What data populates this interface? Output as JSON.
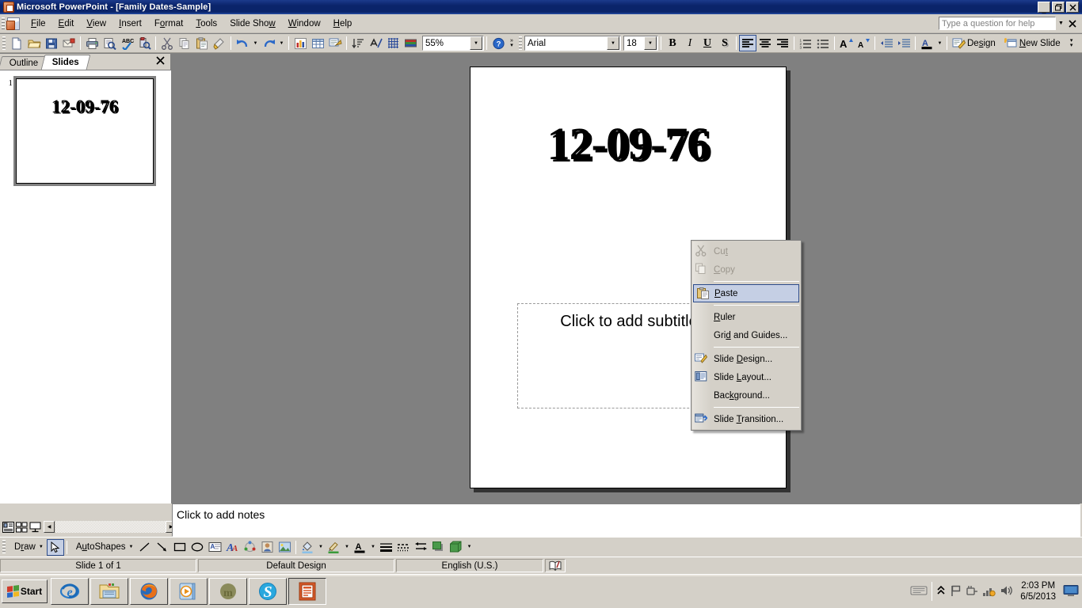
{
  "window": {
    "title": "Microsoft PowerPoint - [Family Dates-Sample]",
    "app_icon": "powerpoint-icon",
    "minimize_label": "_",
    "restore_label": "❐",
    "close_label": "✕"
  },
  "menubar": {
    "items": [
      {
        "label": "File",
        "accel": "F"
      },
      {
        "label": "Edit",
        "accel": "E"
      },
      {
        "label": "View",
        "accel": "V"
      },
      {
        "label": "Insert",
        "accel": "I"
      },
      {
        "label": "Format",
        "accel": "o"
      },
      {
        "label": "Tools",
        "accel": "T"
      },
      {
        "label": "Slide Show",
        "accel": "S"
      },
      {
        "label": "Window",
        "accel": "W"
      },
      {
        "label": "Help",
        "accel": "H"
      }
    ],
    "help_placeholder": "Type a question for help",
    "help_value": "",
    "help_close_label": "✕"
  },
  "standard_toolbar": {
    "zoom_value": "55%",
    "buttons": [
      "new-icon",
      "open-icon",
      "save-icon",
      "mail-icon",
      "print-icon",
      "print-preview-icon",
      "spelling-icon",
      "research-icon",
      "cut-icon",
      "copy-icon",
      "paste-icon",
      "format-painter-icon",
      "undo-icon",
      "redo-icon",
      "insert-chart-icon",
      "insert-table-icon",
      "insert-diagram-icon",
      "sort-icon",
      "expand-all-icon",
      "show-grid-icon",
      "color-grayscale-icon",
      "help-icon"
    ]
  },
  "formatting_toolbar": {
    "font_name": "Arial",
    "font_size": "18",
    "bold_label": "B",
    "italic_label": "I",
    "underline_label": "U",
    "shadow_label": "S",
    "align_left_label": "align-left-icon",
    "align_center_label": "align-center-icon",
    "align_right_label": "align-right-icon",
    "numbering_label": "numbering-icon",
    "bullets_label": "bullets-icon",
    "increase_font_label": "A",
    "decrease_font_label": "A",
    "decrease_indent_label": "decrease-indent-icon",
    "increase_indent_label": "increase-indent-icon",
    "font_color_label": "A",
    "design_label": "Design",
    "design_accel": "s",
    "new_slide_label": "New Slide",
    "new_slide_accel": "N"
  },
  "left_pane": {
    "tabs": [
      {
        "label": "Outline",
        "active": false
      },
      {
        "label": "Slides",
        "active": true
      }
    ],
    "close_label": "✕",
    "slides": [
      {
        "number": "1",
        "title": "12-09-76"
      }
    ]
  },
  "slide": {
    "title": "12-09-76",
    "subtitle_placeholder": "Click to add subtitle"
  },
  "notes": {
    "placeholder": "Click to add notes"
  },
  "view_buttons": [
    "normal-view-icon",
    "slide-sorter-view-icon",
    "slide-show-view-icon"
  ],
  "drawing_toolbar": {
    "draw_label": "Draw",
    "draw_accel": "r",
    "autoshapes_label": "AutoShapes",
    "autoshapes_accel": "u",
    "buttons": [
      "select-objects-icon",
      "line-icon",
      "arrow-icon",
      "rectangle-icon",
      "oval-icon",
      "text-box-icon",
      "wordart-icon",
      "diagram-icon",
      "clip-art-icon",
      "picture-icon",
      "fill-color-icon",
      "line-color-icon",
      "font-color-icon",
      "line-style-icon",
      "dash-style-icon",
      "arrow-style-icon",
      "shadow-style-icon",
      "3d-style-icon"
    ]
  },
  "statusbar": {
    "slide_count": "Slide 1 of 1",
    "design_name": "Default Design",
    "language": "English (U.S.)",
    "spell_icon": "spell-check-icon"
  },
  "context_menu": {
    "items": [
      {
        "label": "Cut",
        "accel": "t",
        "icon": "cut-icon",
        "state": "disabled",
        "separator_after": false
      },
      {
        "label": "Copy",
        "accel": "C",
        "icon": "copy-icon",
        "state": "disabled",
        "separator_after": true
      },
      {
        "label": "Paste",
        "accel": "P",
        "icon": "paste-icon",
        "state": "selected",
        "separator_after": true
      },
      {
        "label": "Ruler",
        "accel": "R",
        "icon": "",
        "state": "normal",
        "separator_after": false
      },
      {
        "label": "Grid and Guides...",
        "accel": "d",
        "icon": "",
        "state": "normal",
        "separator_after": true
      },
      {
        "label": "Slide Design...",
        "accel": "D",
        "icon": "slide-design-icon",
        "state": "normal",
        "separator_after": false
      },
      {
        "label": "Slide Layout...",
        "accel": "L",
        "icon": "slide-layout-icon",
        "state": "normal",
        "separator_after": false
      },
      {
        "label": "Background...",
        "accel": "k",
        "icon": "",
        "state": "normal",
        "separator_after": true
      },
      {
        "label": "Slide Transition...",
        "accel": "T",
        "icon": "slide-transition-icon",
        "state": "normal",
        "separator_after": false
      }
    ]
  },
  "taskbar": {
    "start_label": "Start",
    "quick_launch": [
      "internet-explorer-icon",
      "windows-explorer-icon",
      "firefox-icon",
      "media-player-icon",
      "mcafee-icon",
      "skype-icon"
    ],
    "active_task": "powerpoint-icon",
    "tray_icons": [
      "keyboard-icon",
      "show-hidden-icon",
      "flag-icon",
      "safely-remove-icon",
      "network-icon",
      "volume-icon"
    ],
    "time": "2:03 PM",
    "date": "6/5/2013",
    "desktop_icon": "show-desktop-icon"
  },
  "colors": {
    "title_bar": "#0A246A",
    "chrome": "#D4D0C8",
    "canvas": "#808080",
    "menu_highlight": "#C5CFE4",
    "menu_highlight_border": "#2D4C8A"
  }
}
